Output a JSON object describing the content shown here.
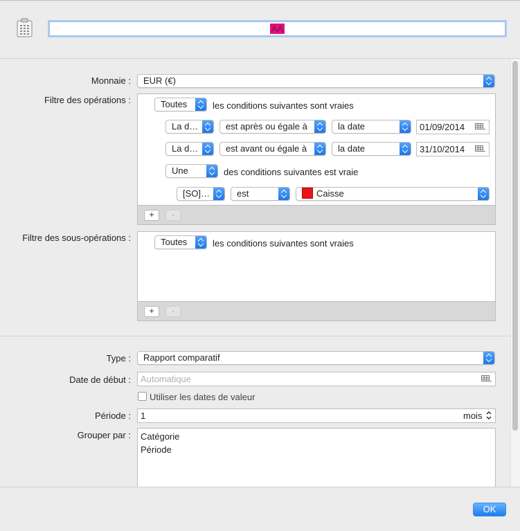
{
  "header": {
    "title_value": "AA"
  },
  "form": {
    "currency": {
      "label": "Monnaie :",
      "value": "EUR (€)"
    },
    "operations_filter": {
      "label": "Filtre des opérations :",
      "match": {
        "value": "Toutes",
        "suffix": "les conditions suivantes sont vraies"
      },
      "rules": [
        {
          "field": "La d…",
          "operator": "est après ou égale à",
          "type": "la date",
          "date": "01/09/2014"
        },
        {
          "field": "La d…",
          "operator": "est avant ou égale à",
          "type": "la date",
          "date": "31/10/2014"
        }
      ],
      "group": {
        "match": {
          "value": "Une",
          "suffix": "des conditions suivantes est vraie"
        },
        "rule": {
          "field": "[SO]…",
          "operator": "est",
          "value": "Caisse",
          "swatch_color": "#e8141a"
        }
      },
      "add_label": "+",
      "remove_label": "-"
    },
    "suboperations_filter": {
      "label": "Filtre des sous-opérations :",
      "match": {
        "value": "Toutes",
        "suffix": "les conditions suivantes sont vraies"
      },
      "add_label": "+",
      "remove_label": "-"
    },
    "type": {
      "label": "Type :",
      "value": "Rapport comparatif"
    },
    "start_date": {
      "label": "Date de début :",
      "placeholder": "Automatique"
    },
    "use_value_dates": {
      "label": "Utiliser les dates de valeur",
      "checked": false
    },
    "period": {
      "label": "Période :",
      "value": "1",
      "unit": "mois"
    },
    "group_by": {
      "label": "Grouper par :",
      "items": [
        "Catégorie",
        "Période"
      ]
    }
  },
  "footer": {
    "ok_label": "OK"
  },
  "colors": {
    "accent": "#1b7ef0",
    "selection": "#e0117b"
  }
}
